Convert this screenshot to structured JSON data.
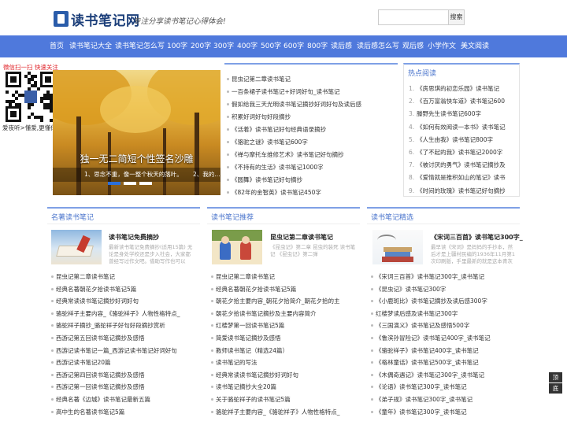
{
  "header": {
    "site_title": "读书笔记网",
    "slogan": "专注分享读书笔记心得体会!",
    "search_placeholder": "",
    "search_label": "搜索"
  },
  "nav": [
    "首页",
    "读书笔记大全",
    "读书笔记怎么写",
    "100字",
    "200字",
    "300字",
    "400字",
    "500字",
    "600字",
    "800字",
    "读后感",
    "读后感怎么写",
    "观后感",
    "小学作文",
    "美文阅读"
  ],
  "wechat": {
    "label": "微信扫一扫 快速关注",
    "footer": "爱夜听>懂爱,更懂你"
  },
  "slider": {
    "title": "独一无二简短个性签名沙雕",
    "desc1": "1、思念不重，像一整个秋天的落叶。",
    "desc2": "2、我的…"
  },
  "top_list": [
    "昆虫记第二章读书笔记",
    "一百条裙子读书笔记+好词好句_读书笔记",
    "假如给我三天光明读书笔记摘抄好词好句及读后感",
    "积累好词好句好段摘抄",
    "《活着》读书笔记好句经典语录摘抄",
    "《骆驼之谜》读书笔记600字",
    "《禅与摩托车维修艺术》读书笔记好句摘抄",
    "《不持有的生活》读书笔记1000字",
    "《圆舞》读书笔记好句摘抄",
    "《82年的金智英》读书笔记450字"
  ],
  "hot": {
    "title": "热点阅读",
    "items": [
      "《房思琪的初恋乐园》读书笔记",
      "《百万富翁快车道》读书笔记600",
      "滕野先生读书笔记600字",
      "《如何有效阅读一本书》读书笔记",
      "《人生由我》读书笔记800字",
      "《了不起的我》读书笔记2000字",
      "《被讨厌的勇气》读书笔记摘抄及",
      "《爱情就是推积如山的笔记》读书",
      "《时间的玫瑰》读书笔记好句摘抄"
    ]
  },
  "sections": [
    {
      "title": "名著读书笔记",
      "feature_title": "读书笔记免费摘抄",
      "feature_desc": "最新读书笔记免费摘抄(适用15篇) 无论是身处学校还是步入社会，大家都曾经写过作文吧。借助写作也可以",
      "items": [
        "昆虫记第二章读书笔记",
        "经典名著朝花夕拾读书笔记5篇",
        "经典常读读书笔记摘抄好词好句",
        "骆驼祥子主要内容_《骆驼祥子》人物性格特点_",
        "骆驼祥子摘抄_骆驼祥子好句好段摘抄赏析",
        "西游记第五回读书笔记摘抄及感悟",
        "西游记读书笔记一篇_西游记读书笔记好词好句",
        "西游记读书笔记20篇",
        "西游记第四回读书笔记摘抄及感悟",
        "西游记第一回读书笔记摘抄及感悟",
        "经典名著《边城》读书笔记最新五篇",
        "高中生的名著读书笔记5篇"
      ]
    },
    {
      "title": "读书笔记推荐",
      "feature_title": "昆虫记第二章读书笔记",
      "feature_desc": "《昆虫记》第二章 昆虫的装死 读书笔记 《昆虫记》第二弹",
      "items": [
        "昆虫记第二章读书笔记",
        "经典名著朝花夕拾读书笔记5篇",
        "朝花夕拾主要内容_朝花夕拾简介_朝花夕拾的主",
        "朝花夕拾读书笔记摘抄及主要内容简介",
        "红楼梦第一回读书笔记5篇",
        "简爱读书笔记摘抄及感悟",
        "教师读书笔记（精选24篇）",
        "读书笔记的写法",
        "经典常读读书笔记摘抄好词好句",
        "读书笔记摘抄大全20篇",
        "关于骆驼祥子的读书笔记5篇",
        "骆驼祥子主要内容_《骆驼祥子》人物性格特点_"
      ]
    },
    {
      "title": "读书笔记精选",
      "feature_title": "《宋词三百首》读书笔记300字_",
      "feature_desc": "最早读《宋词》是妈妈的手抄本，然后才是上疆村民编的1936年11月第1次印刷版，手里最新的就是这本青灰封",
      "items": [
        "《宋词三百首》读书笔记300字_读书笔记",
        "《昆虫记》读书笔记300字",
        "《小鹿斑比》读书笔记摘抄及读后感300字",
        "红楼梦读后感及读书笔记300字",
        "《三国演义》读书笔记及感悟500字",
        "《鲁滨孙冒险记》读书笔记400字_读书笔记",
        "《骆驼祥子》读书笔记400字_读书笔记",
        "《格林童话》读书笔记500字_读书笔记",
        "《木偶奇遇记》读书笔记300字_读书笔记",
        "《论语》读书笔记300字_读书笔记",
        "《弟子规》读书笔记300字_读书笔记",
        "《童年》读书笔记300字_读书笔记"
      ]
    }
  ],
  "side": {
    "top_label": "顶",
    "bottom_label": "底"
  }
}
